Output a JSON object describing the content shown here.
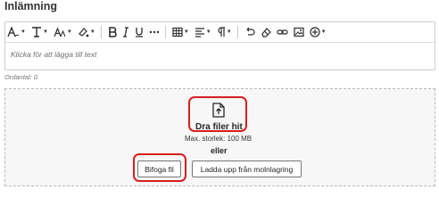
{
  "section_title": "Inlämning",
  "editor": {
    "placeholder": "Klicka för att lägga till text",
    "word_count": "Ordantal: 0",
    "toolbar": [
      "text-style-icon",
      "paragraph-format-icon",
      "font-size-icon",
      "text-color-icon",
      "bold-icon",
      "italic-icon",
      "underline-icon",
      "more-icon",
      "table-icon",
      "align-icon",
      "paragraph-icon",
      "undo-icon",
      "eraser-icon",
      "link-icon",
      "image-icon",
      "add-content-icon"
    ]
  },
  "upload": {
    "drop_text": "Dra filer hit",
    "max_size": "Max. storlek: 100 MB",
    "or_text": "eller",
    "attach_button": "Bifoga fil",
    "cloud_button": "Ladda upp från molnlagring"
  },
  "colors": {
    "highlight": "#d81e1e",
    "dropzone_bg": "#f7f7f7",
    "border": "#cdcdcd"
  }
}
